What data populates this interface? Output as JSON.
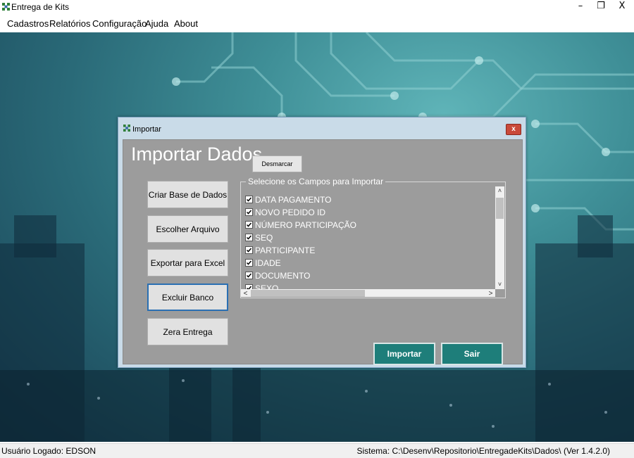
{
  "window": {
    "title": "Entrega de Kits",
    "minimize_icon": "minimize-icon",
    "restore_icon": "restore-icon",
    "close_icon": "close-icon",
    "minimize_glyph": "–",
    "restore_glyph": "❐",
    "close_glyph": "X"
  },
  "menu": [
    {
      "label": "Cadastros"
    },
    {
      "label": "Relatórios"
    },
    {
      "label": "Configuração"
    },
    {
      "label": "Ajuda"
    },
    {
      "label": "About"
    }
  ],
  "dialog": {
    "title": "Importar",
    "close_glyph": "x",
    "heading": "Importar Dados",
    "uncheck_all_label": "Desmarcar Todos",
    "side_buttons": [
      {
        "label": "Criar Base de Dados"
      },
      {
        "label": "Escolher Arquivo"
      },
      {
        "label": "Exportar para Excel"
      },
      {
        "label": "Excluir Banco"
      },
      {
        "label": "Zera Entrega"
      }
    ],
    "fields_group_label": "Selecione os Campos para Importar",
    "fields": [
      {
        "label": "DATA PAGAMENTO",
        "checked": true
      },
      {
        "label": "NOVO PEDIDO ID",
        "checked": true
      },
      {
        "label": "NÚMERO PARTICIPAÇÃO",
        "checked": true
      },
      {
        "label": "SEQ",
        "checked": true
      },
      {
        "label": "PARTICIPANTE",
        "checked": true
      },
      {
        "label": "IDADE",
        "checked": true
      },
      {
        "label": "DOCUMENTO",
        "checked": true
      },
      {
        "label": "SEXO",
        "checked": true
      }
    ],
    "import_label": "Importar",
    "exit_label": "Sair",
    "scroll_up": "˄",
    "scroll_down": "˅",
    "scroll_left": "<",
    "scroll_right": ">"
  },
  "status": {
    "user": "Usuário Logado: EDSON",
    "system": "Sistema: C:\\Desenv\\Repositorio\\EntregadeKits\\Dados\\ (Ver 1.4.2.0)"
  },
  "colors": {
    "accent_button": "#1e7e7a",
    "dialog_client": "#9c9c9c",
    "close_button": "#c94a3a"
  }
}
